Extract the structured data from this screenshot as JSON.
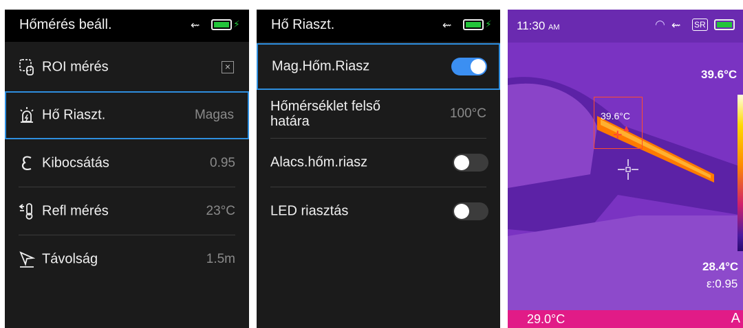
{
  "screen1": {
    "title": "Hőmérés beáll.",
    "items": [
      {
        "label": "ROI mérés",
        "value": ""
      },
      {
        "label": "Hő Riaszt.",
        "value": "Magas"
      },
      {
        "label": "Kibocsátás",
        "value": "0.95"
      },
      {
        "label": "Refl mérés",
        "value": "23°C"
      },
      {
        "label": "Távolság",
        "value": "1.5m"
      }
    ]
  },
  "screen2": {
    "title": "Hő Riaszt.",
    "items": [
      {
        "label": "Mag.Hőm.Riasz",
        "toggle": "on"
      },
      {
        "label_line1": "Hőmérséklet felső",
        "label_line2": "határa",
        "value": "100°C"
      },
      {
        "label": "Alacs.hőm.riasz",
        "toggle": "off"
      },
      {
        "label": "LED riasztás",
        "toggle": "off"
      }
    ]
  },
  "screen3": {
    "time": "11:30",
    "ampm": "AM",
    "sr_badge": "SR",
    "max_temp": "39.6°C",
    "min_temp": "28.4°C",
    "emissivity": "ε:0.95",
    "roi_temp": "39.6°C",
    "center_temp": "29.0°C",
    "mode_letter": "A"
  },
  "colors": {
    "accent": "#2e8fe0",
    "battery": "#23c43a",
    "thermal_background": "#6a2bb1",
    "thermal_bottom_bar": "#e11b87"
  },
  "icons": [
    "usb-icon",
    "battery-icon",
    "roi-icon",
    "alarm-icon",
    "emissivity-icon",
    "reflected-temp-icon",
    "distance-icon",
    "wifi-icon",
    "crosshair-icon"
  ]
}
